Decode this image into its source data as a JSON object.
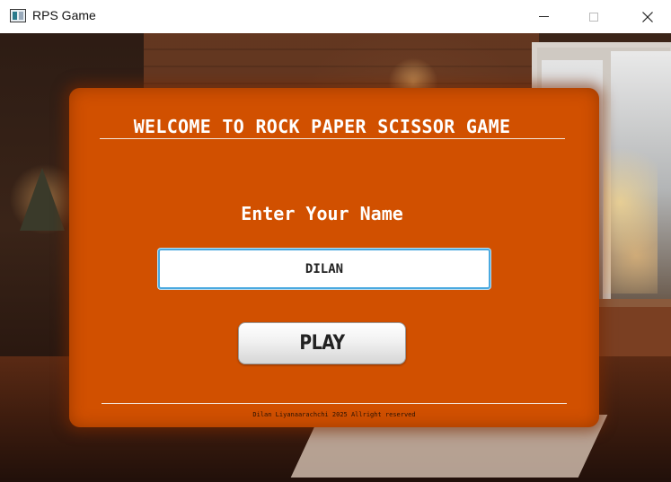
{
  "window": {
    "title": "RPS Game",
    "controls": {
      "minimize": "minimize-icon",
      "maximize": "maximize-icon",
      "close": "close-icon"
    }
  },
  "card": {
    "heading": "WELCOME TO ROCK PAPER SCISSOR GAME",
    "prompt": "Enter Your Name",
    "name_value": "DILAN",
    "play_label": "PLAY",
    "footer": "Dilan Liyanaarachchi 2025 Allright reserved"
  },
  "colors": {
    "card_background": "#d15000",
    "input_border": "#4aa9e0",
    "text_light": "#ffffff"
  }
}
